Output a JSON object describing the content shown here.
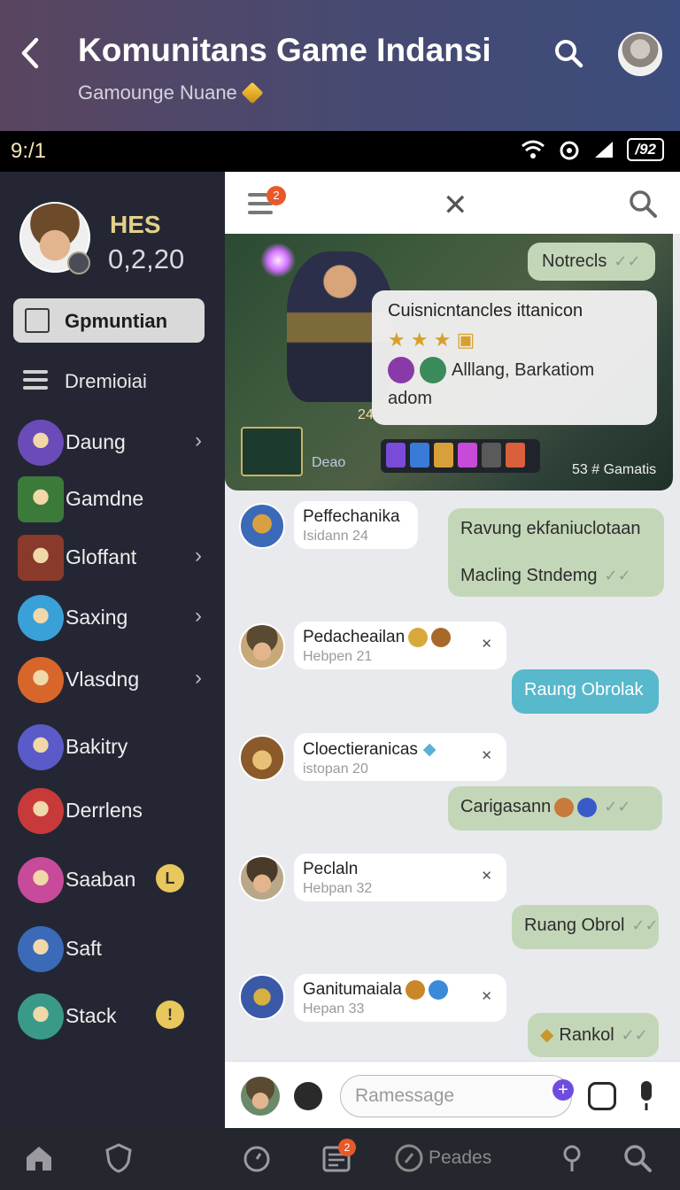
{
  "header": {
    "title": "Komunitans Game Indansi",
    "subtitle": "Gamounge Nuane"
  },
  "status_bar": {
    "time": "9:/1",
    "battery": "/92"
  },
  "sidebar": {
    "profile": {
      "name": "HES",
      "score": "0,2,20"
    },
    "active_item": "Gpmuntian",
    "menu_label": "Dremioiai",
    "items": [
      {
        "label": "Daung",
        "chevron": true,
        "color": "#6b4bb8"
      },
      {
        "label": "Gamdne",
        "chevron": false,
        "color": "#3c7a3a"
      },
      {
        "label": "Gloffant",
        "chevron": true,
        "color": "#8a3a2a"
      },
      {
        "label": "Saxing",
        "chevron": true,
        "color": "#3aa0d8"
      },
      {
        "label": "Vlasdng",
        "chevron": true,
        "color": "#d8662a"
      },
      {
        "label": "Bakitry",
        "chevron": false,
        "color": "#5a5ac8"
      },
      {
        "label": "Derrlens",
        "chevron": false,
        "color": "#c83a3a"
      },
      {
        "label": "Saaban",
        "chevron": false,
        "coin": "L",
        "color": "#c84a9a"
      },
      {
        "label": "Saft",
        "chevron": false,
        "color": "#3a6ab8"
      },
      {
        "label": "Stack",
        "chevron": false,
        "coin": "!",
        "color": "#3a9a8a"
      }
    ]
  },
  "chat": {
    "top_badge": "2",
    "banner": {
      "corner_number": "24",
      "left_text": "Deao",
      "right_text": "53 # Gamatis",
      "note_out": "Notrecls",
      "card_title": "Cuisnicntancles ittanicon",
      "card_names": "Alllang, Barkatiom",
      "card_tail": "adom"
    },
    "messages": [
      {
        "sender": "Peffechanika",
        "sub": "Isidann 24"
      },
      {
        "line1": "Ravung ekfaniuclotaan",
        "line2": "Macling Stndemg"
      },
      {
        "sender": "Pedacheailan",
        "sub": "Hebpen 21"
      },
      {
        "text": "Raung Obrolak"
      },
      {
        "sender": "Cloectieranicas",
        "sub": "istopan 20"
      },
      {
        "text": "Carigasann"
      },
      {
        "sender": "Peclaln",
        "sub": "Hebpan 32"
      },
      {
        "text": "Ruang Obrol"
      },
      {
        "sender": "Ganitumaiala",
        "sub": "Hepan 33"
      },
      {
        "text": "Rankol"
      }
    ],
    "input_placeholder": "Ramessage"
  },
  "bottom_nav": {
    "label": "Peades",
    "badge": "2"
  },
  "colors": {
    "accent_green": "#c3d7b8",
    "accent_blue": "#58b8cc",
    "badge": "#e8592a",
    "sidebar_bg": "#242733"
  }
}
